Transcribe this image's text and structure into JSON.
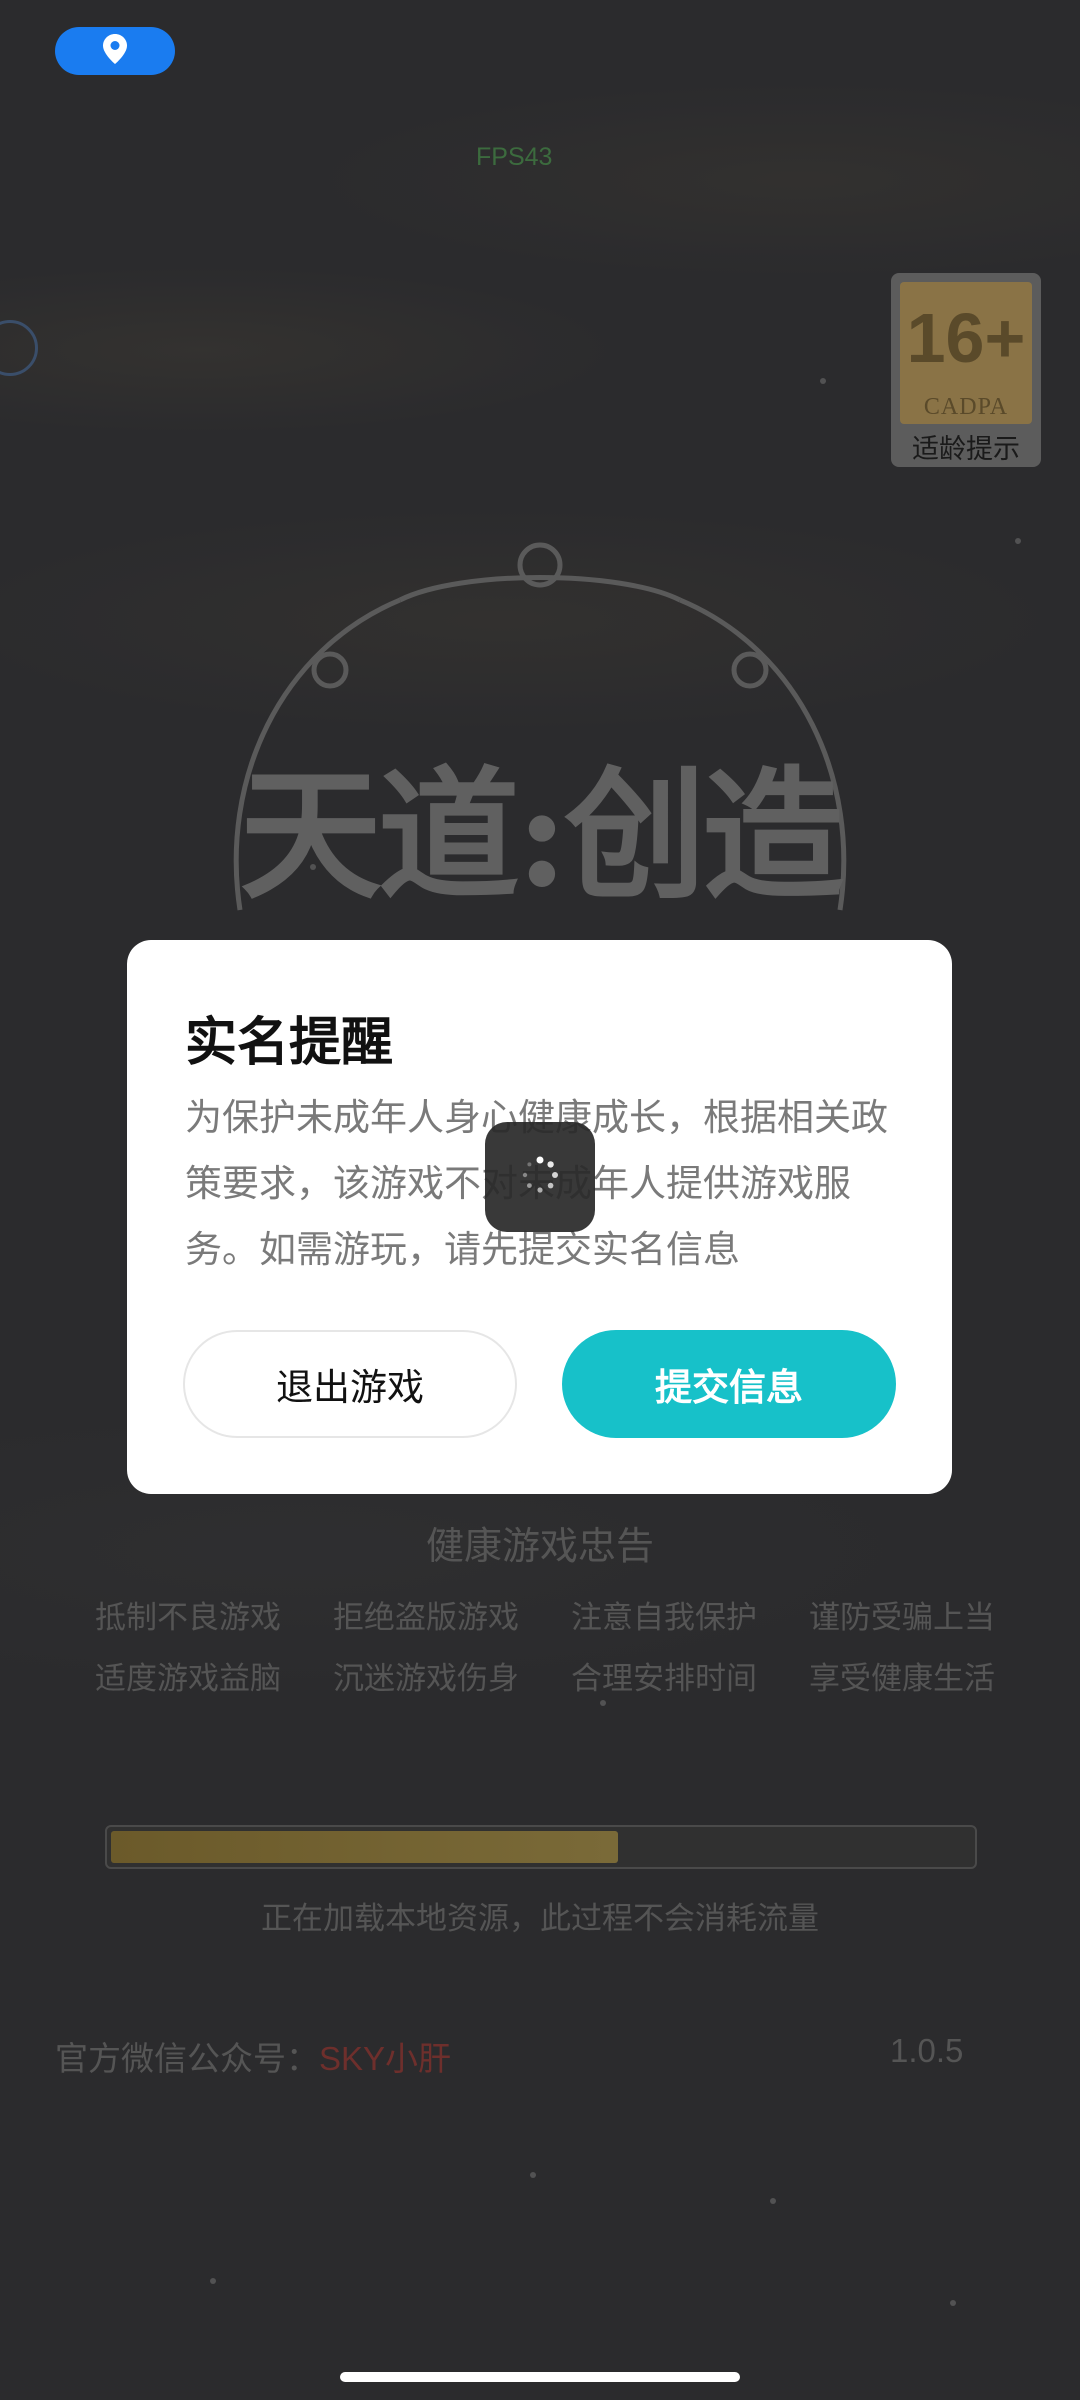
{
  "status": {
    "fps": "FPS43"
  },
  "age_rating": {
    "number": "16+",
    "org": "CADPA",
    "label": "适龄提示",
    "color": "#8a7346"
  },
  "game": {
    "title": "天道:创造"
  },
  "dialog": {
    "title": "实名提醒",
    "body": "为保护未成年人身心健康成长，根据相关政策要求，该游戏不对未成年人提供游戏服务。如需游玩，请先提交实名信息",
    "exit_label": "退出游戏",
    "submit_label": "提交信息",
    "accent": "#17c1c9"
  },
  "health_notice": {
    "title": "健康游戏忠告",
    "row1": [
      "抵制不良游戏",
      "拒绝盗版游戏",
      "注意自我保护",
      "谨防受骗上当"
    ],
    "row2": [
      "适度游戏益脑",
      "沉迷游戏伤身",
      "合理安排时间",
      "享受健康生活"
    ]
  },
  "loading": {
    "progress": 0.59,
    "text": "正在加载本地资源，此过程不会消耗流量"
  },
  "footer": {
    "wechat_label": "官方微信公众号：",
    "wechat_account": "SKY小肝",
    "version": "1.0.5"
  },
  "icons": {
    "location": "location-pin-icon",
    "spinner": "loading-spinner-icon"
  }
}
